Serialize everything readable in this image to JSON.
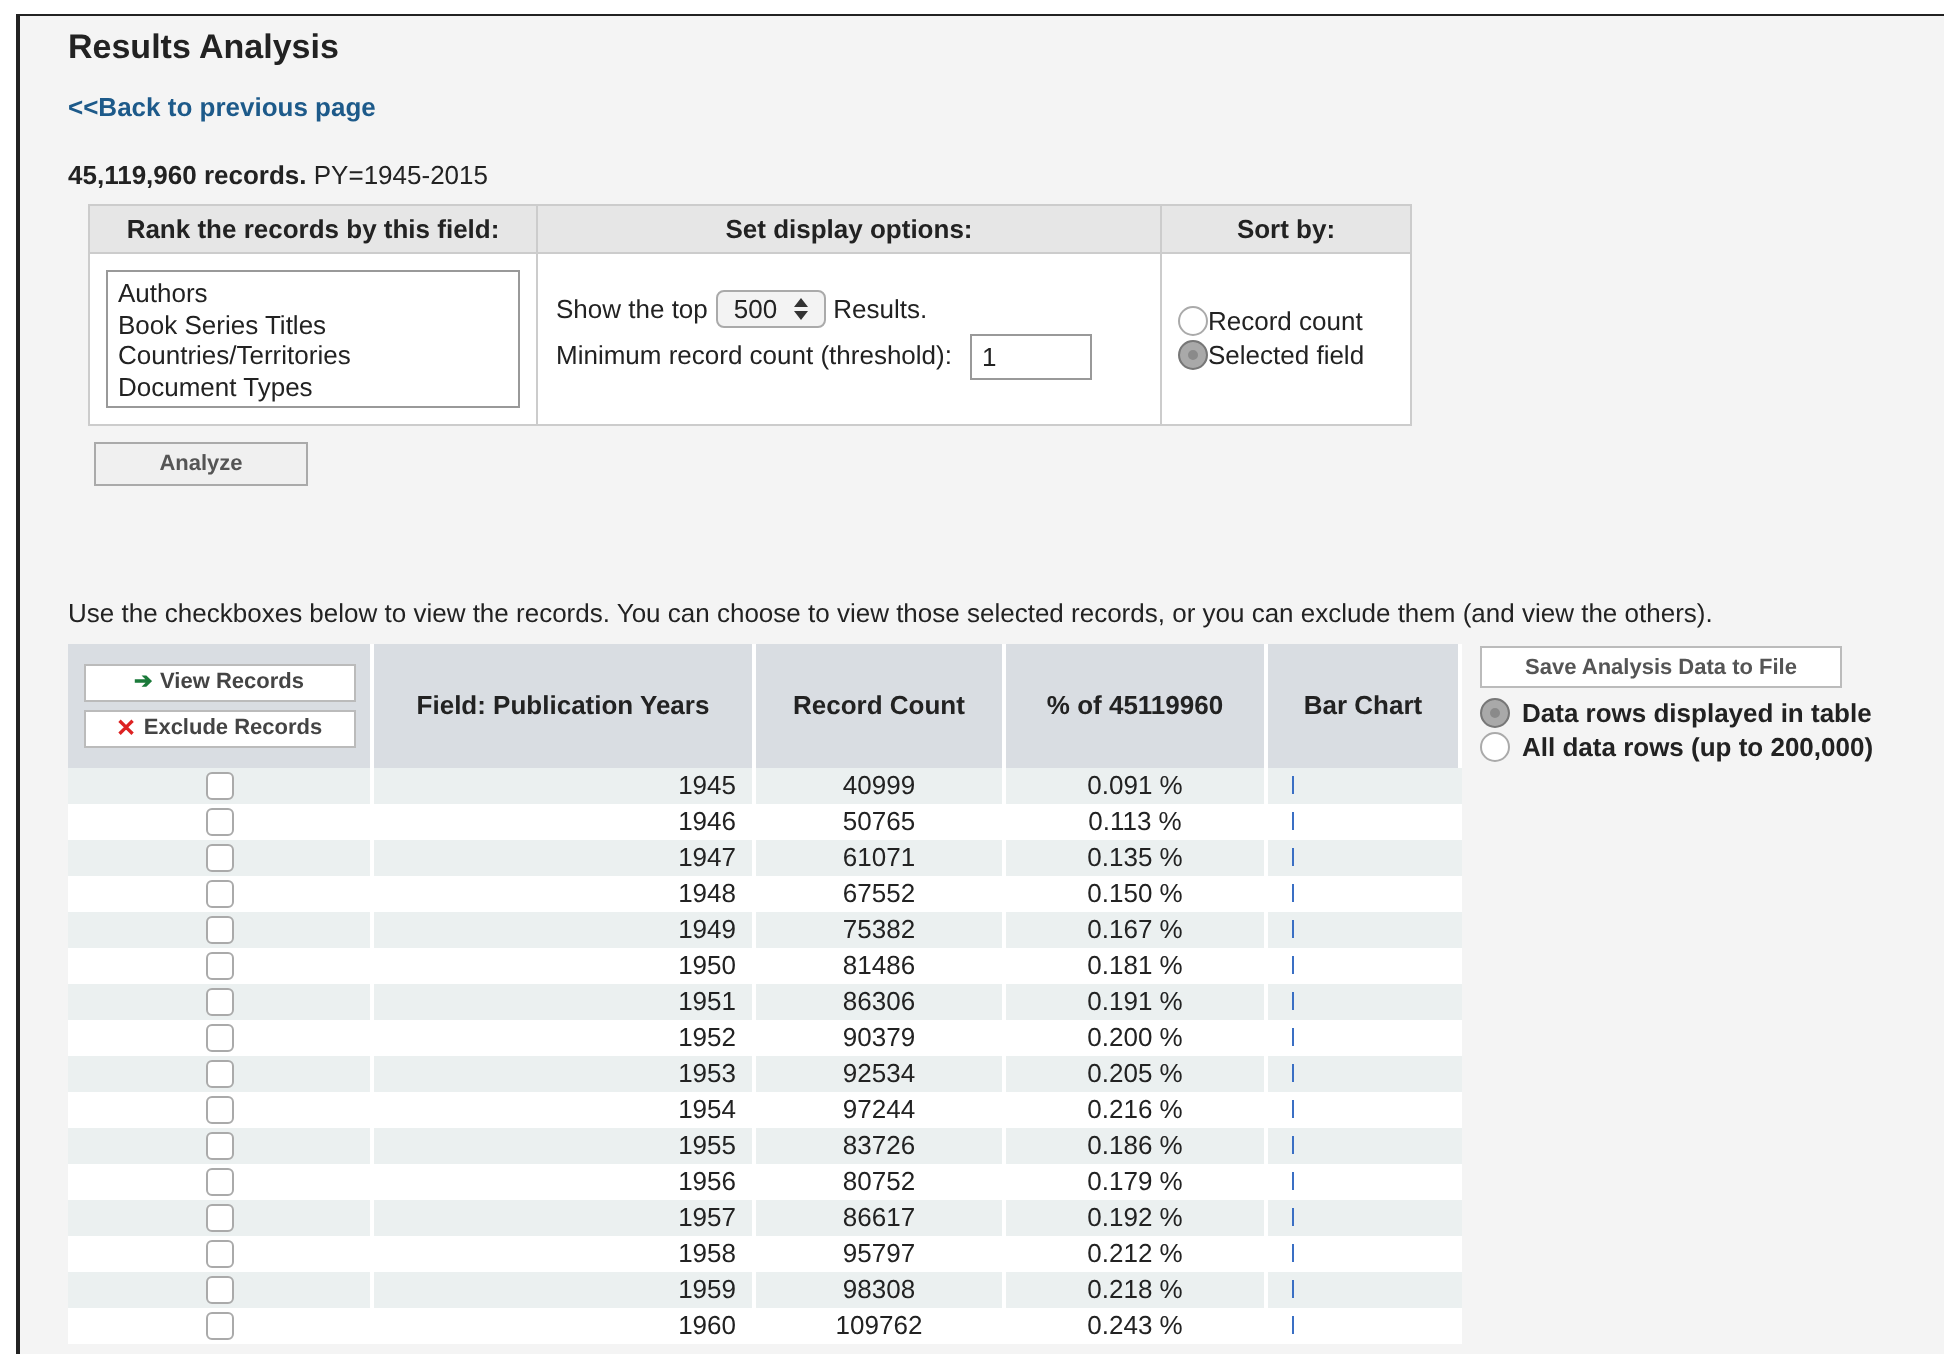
{
  "title": "Results Analysis",
  "back_link": "<<Back to previous page",
  "summary": {
    "count": "45,119,960 records.",
    "query": "PY=1945-2015"
  },
  "options": {
    "columns": [
      "Rank the records by this field:",
      "Set display options:",
      "Sort by:"
    ],
    "fields": [
      "Authors",
      "Book Series Titles",
      "Countries/Territories",
      "Document Types"
    ],
    "show_top_label": "Show the top",
    "show_top_value": "500",
    "results_label": "Results.",
    "threshold_label": "Minimum record count (threshold):",
    "threshold_value": "1",
    "sort": [
      {
        "label": "Record count",
        "selected": false
      },
      {
        "label": "Selected field",
        "selected": true
      }
    ]
  },
  "analyze_button": "Analyze",
  "instructions": "Use the checkboxes below to view the records. You can choose to view those selected records, or you can exclude them (and view the others).",
  "view_button": "View Records",
  "view_icon": "➔",
  "exclude_button": "Exclude Records",
  "exclude_icon": "✕",
  "table": {
    "columns": [
      "Field: Publication Years",
      "Record Count",
      "% of 45119960",
      "Bar Chart"
    ],
    "rows": [
      {
        "year": "1945",
        "count": "40999",
        "percent": "0.091 %",
        "checked": false
      },
      {
        "year": "1946",
        "count": "50765",
        "percent": "0.113 %",
        "checked": false
      },
      {
        "year": "1947",
        "count": "61071",
        "percent": "0.135 %",
        "checked": false
      },
      {
        "year": "1948",
        "count": "67552",
        "percent": "0.150 %",
        "checked": false
      },
      {
        "year": "1949",
        "count": "75382",
        "percent": "0.167 %",
        "checked": false
      },
      {
        "year": "1950",
        "count": "81486",
        "percent": "0.181 %",
        "checked": false
      },
      {
        "year": "1951",
        "count": "86306",
        "percent": "0.191 %",
        "checked": false
      },
      {
        "year": "1952",
        "count": "90379",
        "percent": "0.200 %",
        "checked": false
      },
      {
        "year": "1953",
        "count": "92534",
        "percent": "0.205 %",
        "checked": false
      },
      {
        "year": "1954",
        "count": "97244",
        "percent": "0.216 %",
        "checked": false
      },
      {
        "year": "1955",
        "count": "83726",
        "percent": "0.186 %",
        "checked": false
      },
      {
        "year": "1956",
        "count": "80752",
        "percent": "0.179 %",
        "checked": false
      },
      {
        "year": "1957",
        "count": "86617",
        "percent": "0.192 %",
        "checked": false
      },
      {
        "year": "1958",
        "count": "95797",
        "percent": "0.212 %",
        "checked": false
      },
      {
        "year": "1959",
        "count": "98308",
        "percent": "0.218 %",
        "checked": false
      },
      {
        "year": "1960",
        "count": "109762",
        "percent": "0.243 %",
        "checked": false
      }
    ]
  },
  "save": {
    "button": "Save Analysis Data to File",
    "options": [
      {
        "label": "Data rows displayed in table",
        "selected": true
      },
      {
        "label": "All data rows (up to 200,000)",
        "selected": false
      }
    ]
  }
}
